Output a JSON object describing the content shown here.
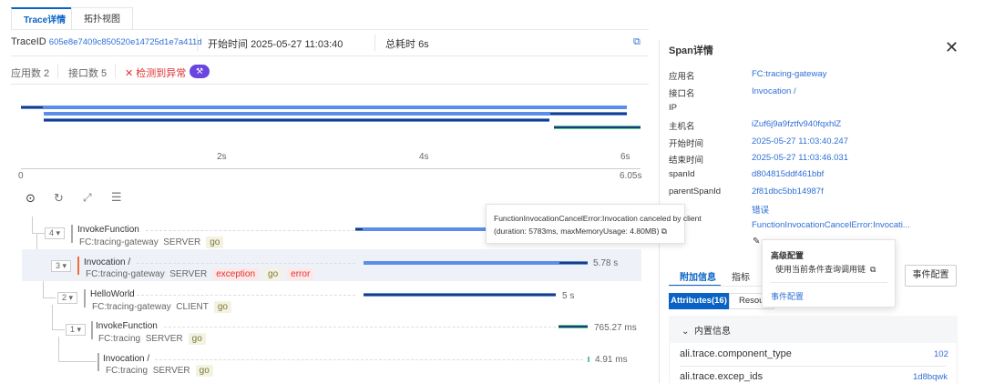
{
  "tabs": [
    {
      "label": "Trace详情",
      "active": true
    },
    {
      "label": "拓扑视图",
      "active": false
    }
  ],
  "header": {
    "traceid_label": "TraceID",
    "traceid": "605e8e7409c850520e14725d1e7a411d",
    "start_label": "开始时间",
    "start": "2025-05-27 11:03:40",
    "total_label": "总耗时",
    "total": "6s"
  },
  "stats": {
    "apps": "应用数 2",
    "interfaces": "接口数 5",
    "anomaly": "检测到异常"
  },
  "axis": {
    "ticks": [
      "2s",
      "4s",
      "6s"
    ],
    "start": "0",
    "end": "6.05s"
  },
  "spans": [
    {
      "count": "4",
      "name": "InvokeFunction",
      "app": "FC:tracing-gateway",
      "kind": "SERVER",
      "tags": [
        "go"
      ],
      "duration": ""
    },
    {
      "count": "3",
      "name": "Invocation /",
      "app": "FC:tracing-gateway",
      "kind": "SERVER",
      "tags": [
        "exception",
        "go",
        "error"
      ],
      "duration": "5.78 s"
    },
    {
      "count": "2",
      "name": "HelloWorld",
      "app": "FC:tracing-gateway",
      "kind": "CLIENT",
      "tags": [
        "go"
      ],
      "duration": "5 s"
    },
    {
      "count": "1",
      "name": "InvokeFunction",
      "app": "FC:tracing",
      "kind": "SERVER",
      "tags": [
        "go"
      ],
      "duration": "765.27 ms"
    },
    {
      "count": "",
      "name": "Invocation /",
      "app": "FC:tracing",
      "kind": "SERVER",
      "tags": [
        "go"
      ],
      "duration": "4.91 ms"
    }
  ],
  "tooltip": {
    "line1": "FunctionInvocationCancelError:Invocation canceled by client",
    "line2": "(duration: 5783ms, maxMemoryUsage: 4.80MB)"
  },
  "panel": {
    "title": "Span详情",
    "fields": [
      {
        "label": "应用名",
        "value": "FC:tracing-gateway"
      },
      {
        "label": "接口名",
        "value": "Invocation /"
      },
      {
        "label": "IP",
        "value": ""
      },
      {
        "label": "主机名",
        "value": "iZuf6j9a9fztfv940fqxhlZ"
      },
      {
        "label": "开始时间",
        "value": "2025-05-27 11:03:40.247"
      },
      {
        "label": "结束时间",
        "value": "2025-05-27 11:03:46.031"
      },
      {
        "label": "spanId",
        "value": "d804815ddf461bbf"
      },
      {
        "label": "parentSpanId",
        "value": "2f81dbc5bb14987f"
      },
      {
        "label": "",
        "value": "错误"
      },
      {
        "label": "",
        "value": "FunctionInvocationCancelError:Invocati..."
      }
    ],
    "tabs": [
      "附加信息",
      "指标"
    ],
    "event_button": "事件配置",
    "subtabs": [
      "Attributes(16)",
      "Resou"
    ],
    "section": "内置信息",
    "attrs": [
      {
        "key": "ali.trace.component_type",
        "value": "102"
      },
      {
        "key": "ali.trace.excep_ids",
        "value": "1d8bqwk"
      }
    ]
  },
  "popover": {
    "title": "高级配置",
    "item": "使用当前条件查询调用链",
    "link": "事件配置"
  }
}
